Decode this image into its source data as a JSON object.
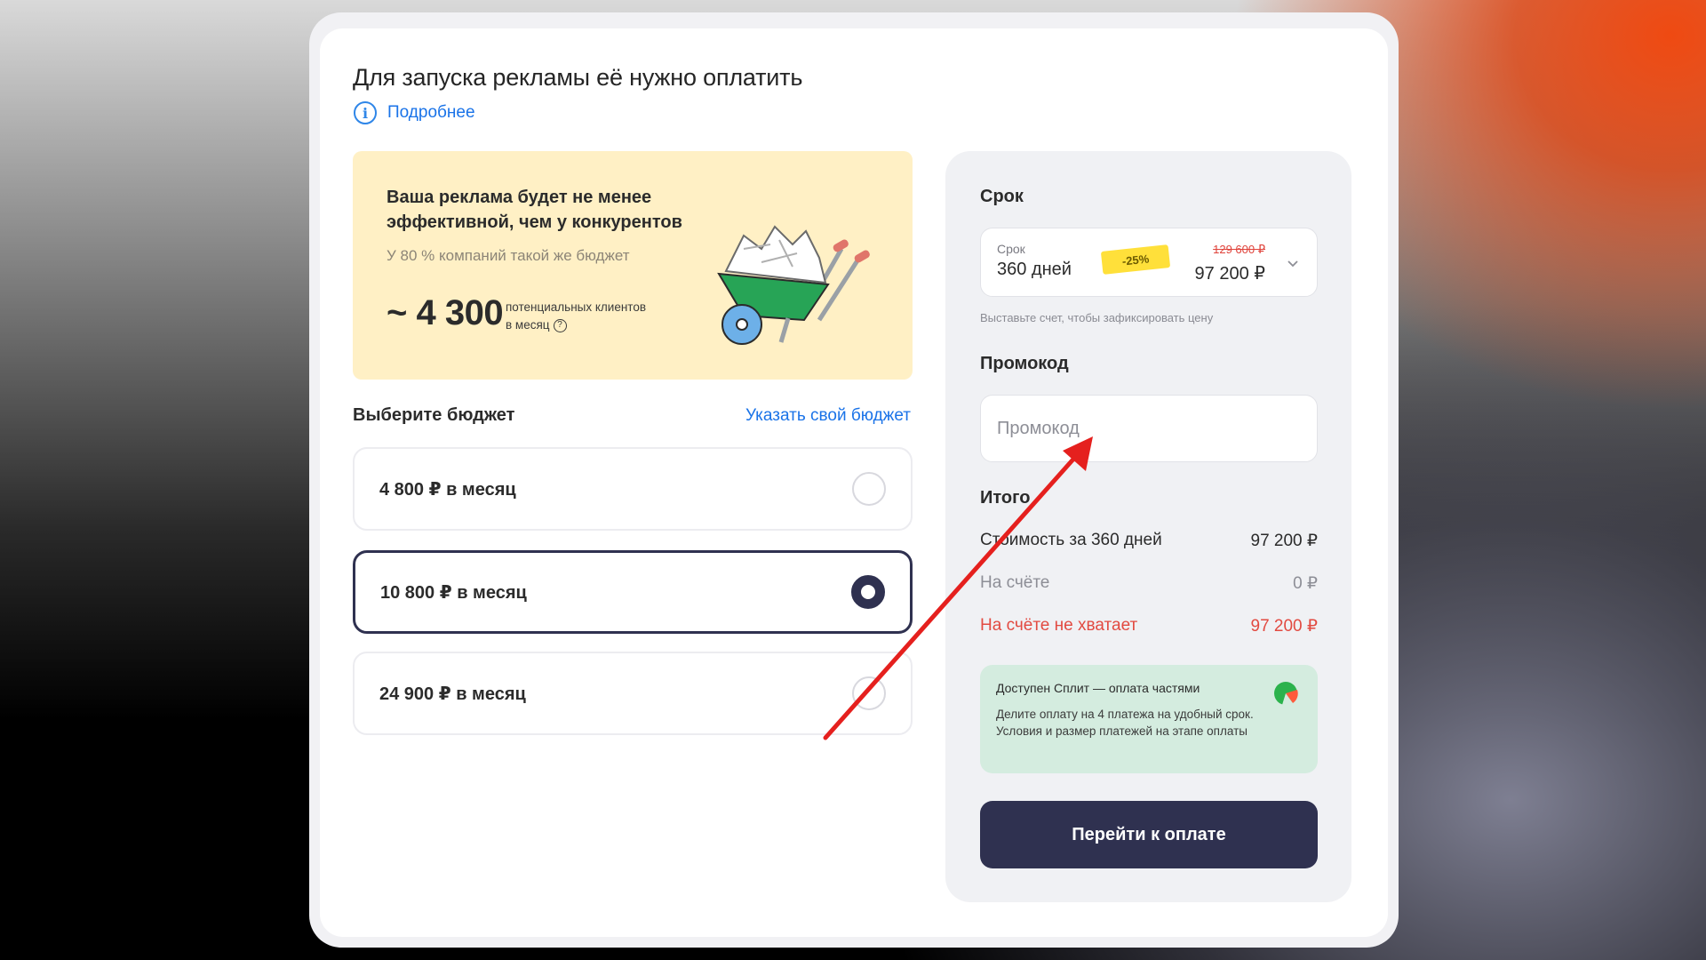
{
  "header": {
    "title": "Для запуска рекламы её нужно оплатить",
    "more_link": "Подробнее"
  },
  "promo_card": {
    "headline": "Ваша реклама будет не менее эффективной, чем у конкурентов",
    "subtitle": "У 80 % компаний такой же бюджет",
    "clients_value": "~ 4 300",
    "clients_note_line1": "потенциальных клиентов",
    "clients_note_line2": "в месяц",
    "help_glyph": "?",
    "illustration_icon": "wheelbarrow-icon"
  },
  "budget": {
    "label": "Выберите бюджет",
    "custom_link": "Указать свой бюджет",
    "options": [
      {
        "label": "4 800 ₽ в месяц",
        "selected": false
      },
      {
        "label": "10 800 ₽ в месяц",
        "selected": true
      },
      {
        "label": "24 900 ₽ в месяц",
        "selected": false
      }
    ]
  },
  "period": {
    "section_label": "Срок",
    "field_label": "Срок",
    "value": "360 дней",
    "discount_badge": "-25%",
    "old_price": "129 600 ₽",
    "new_price": "97 200 ₽",
    "hint": "Выставьте счет, чтобы зафиксировать цену"
  },
  "promocode": {
    "section_label": "Промокод",
    "placeholder": "Промокод",
    "value": ""
  },
  "total": {
    "section_label": "Итого",
    "rows": [
      {
        "label": "Стоимость за 360 дней",
        "value": "97 200 ₽",
        "style": "dark"
      },
      {
        "label": "На счёте",
        "value": "0 ₽",
        "style": "grey"
      },
      {
        "label": "На счёте не хватает",
        "value": "97 200 ₽",
        "style": "red"
      }
    ]
  },
  "split": {
    "title": "Доступен Сплит — оплата частями",
    "description": "Делите оплату на 4 платежа на удобный срок. Условия и размер платежей на этапе оплаты"
  },
  "pay_button": {
    "label": "Перейти к оплате"
  },
  "colors": {
    "accent_link": "#1a73e8",
    "primary_dark": "#2f3150",
    "promo_bg": "#fff0c5",
    "split_bg": "#d4ecdf",
    "error_red": "#e24a41",
    "annotation_arrow": "#e5201e"
  }
}
